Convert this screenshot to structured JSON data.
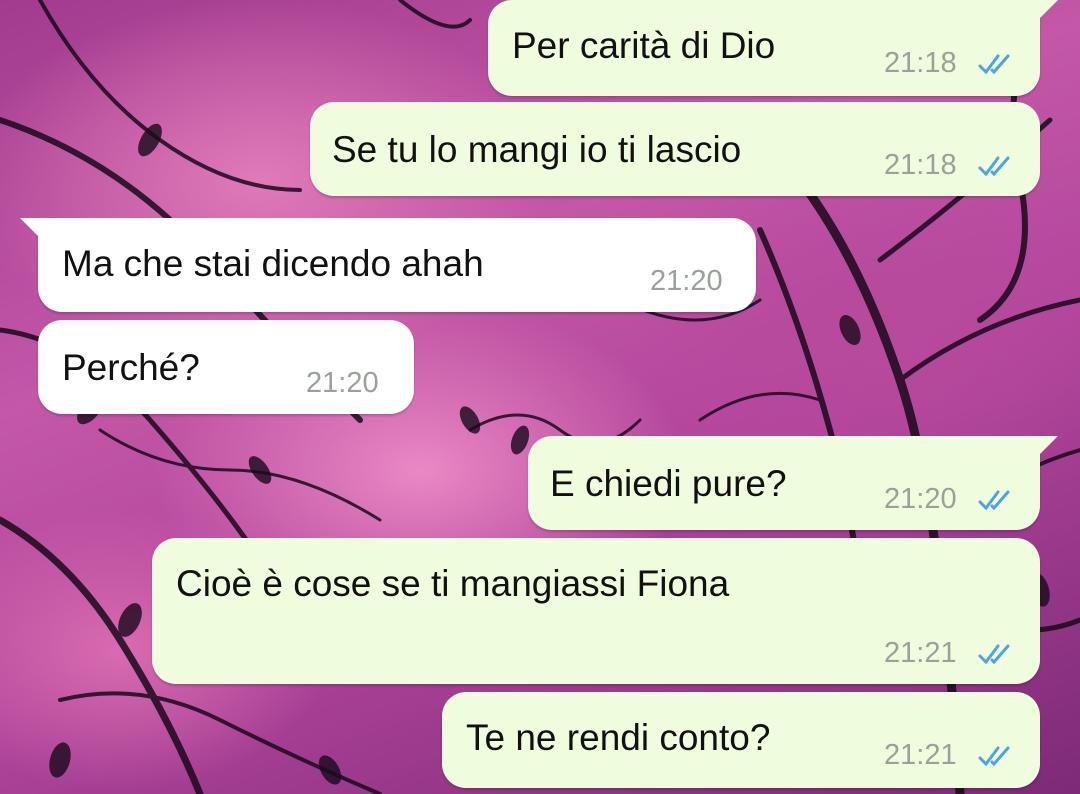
{
  "colors": {
    "outgoing_bubble": "#effdde",
    "incoming_bubble": "#ffffff",
    "timestamp": "#9aa19a",
    "read_checks": "#4fa3e0"
  },
  "messages": [
    {
      "direction": "out",
      "text": "Per carità di Dio",
      "time": "21:18",
      "status_icon": "double-check-read-icon"
    },
    {
      "direction": "out",
      "text": "Se tu lo mangi io ti lascio",
      "time": "21:18",
      "status_icon": "double-check-read-icon"
    },
    {
      "direction": "in",
      "text": "Ma che stai dicendo ahah",
      "time": "21:20"
    },
    {
      "direction": "in",
      "text": "Perché?",
      "time": "21:20"
    },
    {
      "direction": "out",
      "text": "E chiedi pure?",
      "time": "21:20",
      "status_icon": "double-check-read-icon"
    },
    {
      "direction": "out",
      "text": "Cioè è cose se ti mangiassi Fiona",
      "time": "21:21",
      "status_icon": "double-check-read-icon"
    },
    {
      "direction": "out",
      "text": "Te ne rendi conto?",
      "time": "21:21",
      "status_icon": "double-check-read-icon"
    }
  ]
}
